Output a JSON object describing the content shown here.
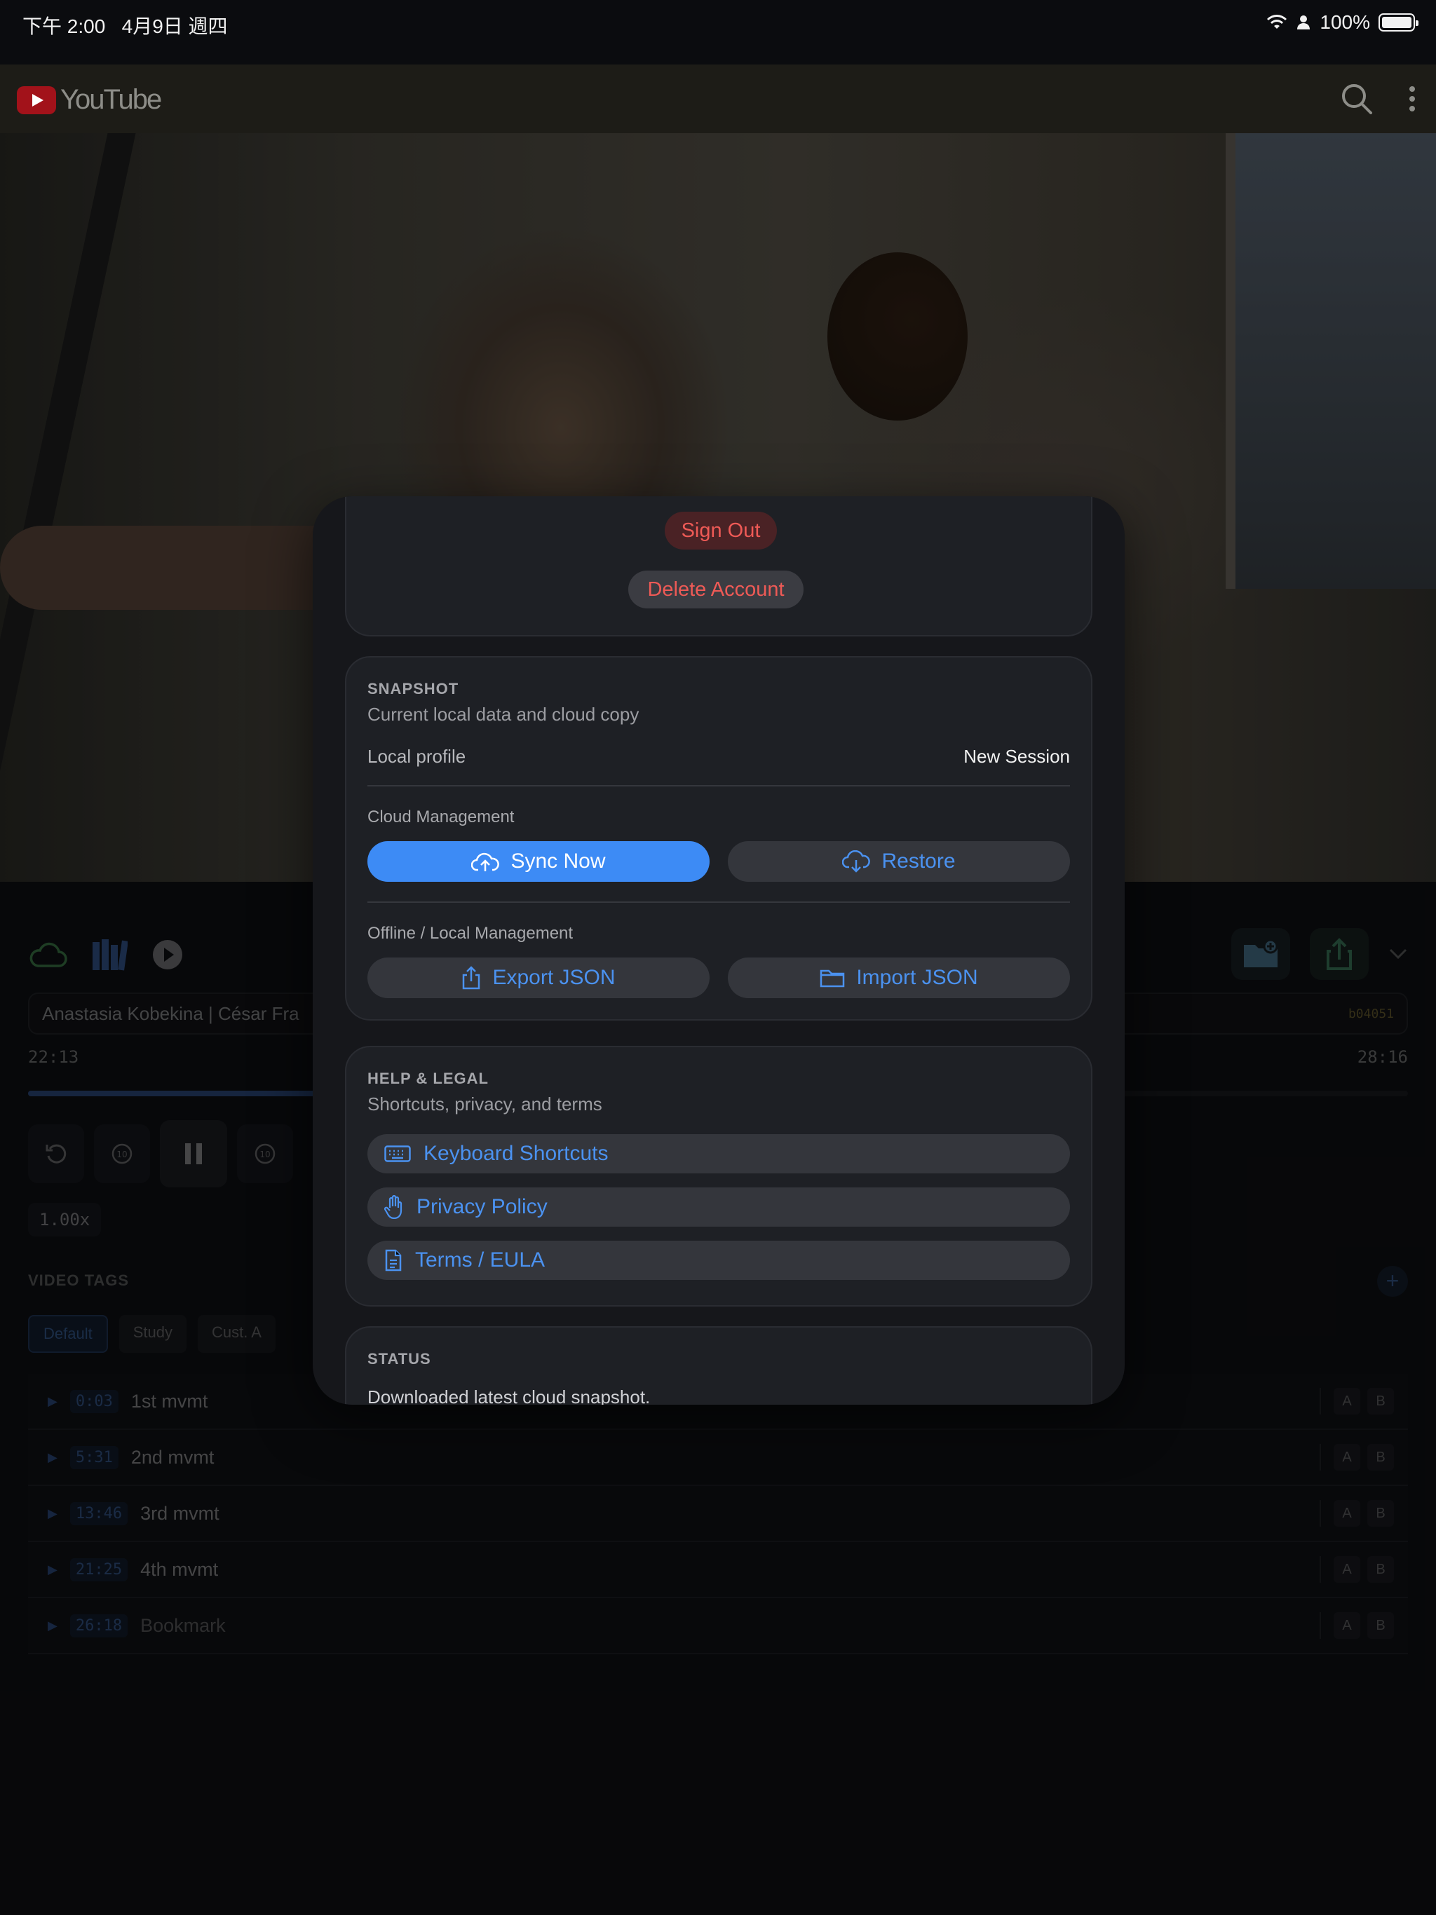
{
  "status_bar": {
    "time": "下午 2:00",
    "date": "4月9日 週四",
    "battery": "100%"
  },
  "youtube": {
    "logo_text": "YouTube",
    "icons": [
      "search-icon",
      "more-vert-icon"
    ]
  },
  "player": {
    "video_title": "Anastasia Kobekina | César Fra",
    "video_id": "b04051",
    "current_time": "22:13",
    "duration": "28:16",
    "progress_fraction": 0.786,
    "playback_rate": "1.00x",
    "left_icons": [
      "cloud-icon",
      "library-icon",
      "play-circle-icon"
    ],
    "right_icons": [
      "folder-add-icon",
      "share-icon",
      "chevron-down-icon"
    ],
    "transport_icons": [
      "restart-icon",
      "rewind-10-icon",
      "pause-icon",
      "forward-10-icon"
    ]
  },
  "tags": {
    "heading": "VIDEO TAGS",
    "add_label": "+",
    "pills": [
      "Default",
      "Study",
      "Cust. A"
    ],
    "active_pill": "Default"
  },
  "chapters": [
    {
      "time": "0:03",
      "label": "1st mvmt",
      "a": "A",
      "b": "B"
    },
    {
      "time": "5:31",
      "label": "2nd mvmt",
      "a": "A",
      "b": "B"
    },
    {
      "time": "13:46",
      "label": "3rd mvmt",
      "a": "A",
      "b": "B"
    },
    {
      "time": "21:25",
      "label": "4th mvmt",
      "a": "A",
      "b": "B"
    },
    {
      "time": "26:18",
      "label": "Bookmark",
      "a": "A",
      "b": "B"
    }
  ],
  "sheet": {
    "account": {
      "sign_out": "Sign Out",
      "delete_account": "Delete Account"
    },
    "snapshot": {
      "heading": "SNAPSHOT",
      "subtitle": "Current local data and cloud copy",
      "local_profile_label": "Local profile",
      "local_profile_value": "New Session",
      "cloud_heading": "Cloud Management",
      "sync_now": "Sync Now",
      "restore": "Restore",
      "offline_heading": "Offline / Local Management",
      "export_json": "Export JSON",
      "import_json": "Import JSON"
    },
    "help": {
      "heading": "HELP & LEGAL",
      "subtitle": "Shortcuts, privacy, and terms",
      "keyboard_shortcuts": "Keyboard Shortcuts",
      "privacy_policy": "Privacy Policy",
      "terms": "Terms / EULA"
    },
    "status": {
      "heading": "STATUS",
      "message": "Downloaded latest cloud snapshot."
    }
  },
  "colors": {
    "accent_blue": "#3d8bf5",
    "destructive_red": "#ee5a56",
    "sheet_bg": "#16171b"
  }
}
